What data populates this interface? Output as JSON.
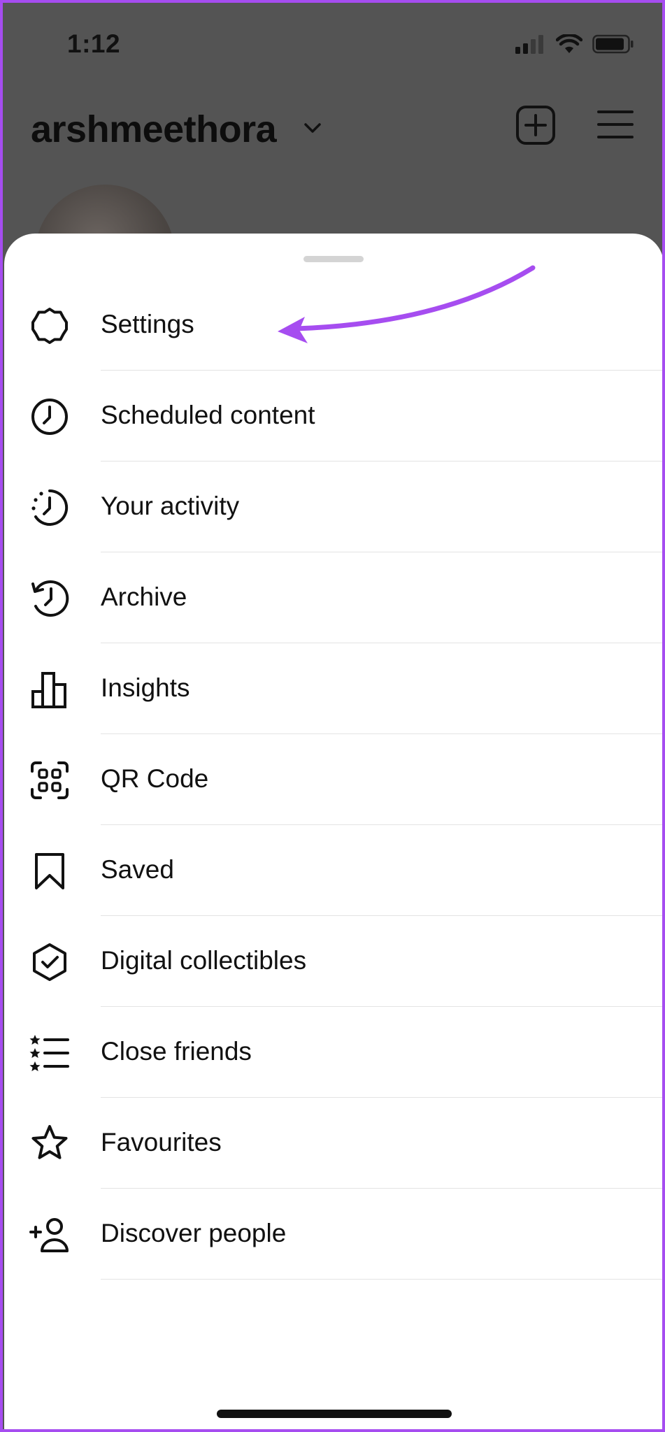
{
  "status_bar": {
    "time": "1:12"
  },
  "profile_header": {
    "username": "arshmeethora"
  },
  "menu": {
    "items": [
      {
        "label": "Settings",
        "icon": "settings-icon"
      },
      {
        "label": "Scheduled content",
        "icon": "clock-icon"
      },
      {
        "label": "Your activity",
        "icon": "activity-icon"
      },
      {
        "label": "Archive",
        "icon": "archive-icon"
      },
      {
        "label": "Insights",
        "icon": "insights-icon"
      },
      {
        "label": "QR Code",
        "icon": "qr-code-icon"
      },
      {
        "label": "Saved",
        "icon": "bookmark-icon"
      },
      {
        "label": "Digital collectibles",
        "icon": "collectibles-icon"
      },
      {
        "label": "Close friends",
        "icon": "close-friends-icon"
      },
      {
        "label": "Favourites",
        "icon": "star-icon"
      },
      {
        "label": "Discover people",
        "icon": "add-person-icon"
      }
    ]
  },
  "colors": {
    "annotation": "#a64df0",
    "overlay": "#545454",
    "sheet": "#ffffff",
    "text": "#111111"
  }
}
